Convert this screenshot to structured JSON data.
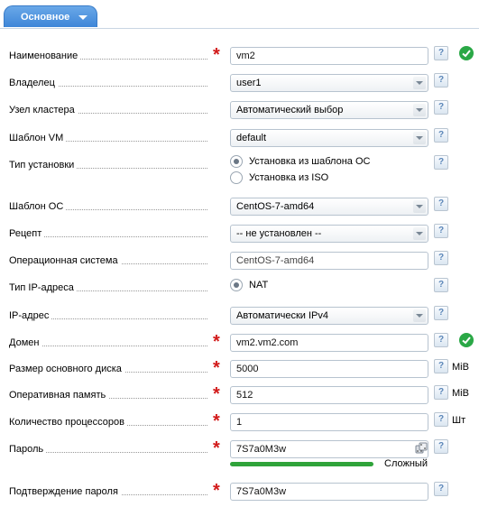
{
  "tab": {
    "label": "Основное"
  },
  "fields": {
    "name": {
      "label": "Наименование",
      "value": "vm2",
      "status": "ok"
    },
    "owner": {
      "label": "Владелец",
      "value": "user1"
    },
    "node": {
      "label": "Узел кластера",
      "value": "Автоматический выбор"
    },
    "vm_template": {
      "label": "Шаблон VM",
      "value": "default"
    },
    "install_type": {
      "label": "Тип установки",
      "options": [
        "Установка из шаблона ОС",
        "Установка из ISO"
      ],
      "selected": "Установка из шаблона ОС"
    },
    "os_template": {
      "label": "Шаблон ОС",
      "value": "CentOS-7-amd64"
    },
    "recipe": {
      "label": "Рецепт",
      "value": "-- не установлен --"
    },
    "os": {
      "label": "Операционная система",
      "value": "CentOS-7-amd64"
    },
    "ip_type": {
      "label": "Тип IP-адреса",
      "option": "NAT",
      "selected": true
    },
    "ip": {
      "label": "IP-адрес",
      "value": "Автоматически IPv4"
    },
    "domain": {
      "label": "Домен",
      "value": "vm2.vm2.com",
      "status": "ok"
    },
    "disk": {
      "label": "Размер основного диска",
      "value": "5000",
      "unit": "MiB"
    },
    "ram": {
      "label": "Оперативная память",
      "value": "512",
      "unit": "MiB"
    },
    "cpu": {
      "label": "Количество процессоров",
      "value": "1",
      "unit": "Шт"
    },
    "password": {
      "label": "Пароль",
      "value": "7S7a0M3w",
      "strength": "Сложный",
      "strength_level": 1.0
    },
    "password_confirm": {
      "label": "Подтверждение пароля",
      "value": "7S7a0M3w"
    }
  },
  "ui": {
    "required_mark": "*",
    "help_mark": "?"
  },
  "colors": {
    "accent": "#3d86d8",
    "required": "#d21a1a",
    "ok": "#2aa846",
    "strength": "#2fa33a"
  }
}
